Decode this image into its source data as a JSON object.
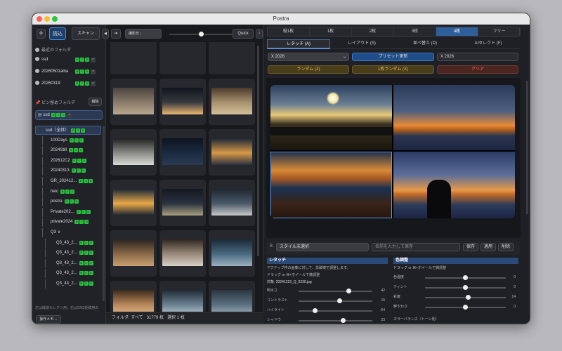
{
  "window": {
    "title": "Postra"
  },
  "left": {
    "gear": "⚙",
    "read": "読込",
    "scan": "スキャン",
    "collapse": "◀",
    "recent_header": "最近のフォルダ",
    "recent": [
      {
        "name": "ssd"
      },
      {
        "name": "20260501aiba"
      },
      {
        "name": "20260319"
      }
    ],
    "badges": [
      "B",
      "C",
      "D"
    ],
    "x": "×",
    "pin_header": "ピン留めフォルダ",
    "unpin": "解除",
    "pinned": "ssd",
    "tree": [
      {
        "name": "ssd（全体）",
        "level": 0,
        "badges": true,
        "selected": true
      },
      {
        "name": "100Days",
        "level": 1,
        "badges": true
      },
      {
        "name": "2024Still",
        "level": 1,
        "badges": true
      },
      {
        "name": "202612C2",
        "level": 1,
        "badges": true
      },
      {
        "name": "20240313",
        "level": 1,
        "badges": true
      },
      {
        "name": "GR_202412...",
        "level": 1,
        "badges": true
      },
      {
        "name": "heic",
        "level": 1,
        "badges": true
      },
      {
        "name": "postra",
        "level": 1,
        "badges": true
      },
      {
        "name": "Private202...",
        "level": 1,
        "badges": true
      },
      {
        "name": "private2024",
        "level": 1,
        "badges": true
      },
      {
        "name": "Q3",
        "level": 1,
        "badges": false,
        "toggle": "∨"
      },
      {
        "name": "Q3_43_2...",
        "level": 2,
        "badges": true
      },
      {
        "name": "Q3_43_2...",
        "level": 2,
        "badges": true
      },
      {
        "name": "Q3_43_2...",
        "level": 2,
        "badges": true
      },
      {
        "name": "Q3_43_2...",
        "level": 2,
        "badges": true
      },
      {
        "name": "Q3_43_2...",
        "level": 2,
        "badges": true
      }
    ],
    "hint": "左は爆速セレクト用。右はSNS投稿用の",
    "memo": "操作メモ ⌄"
  },
  "mid": {
    "arrow": "➔",
    "sort": "撮影日 ↓",
    "quick": "Quick",
    "info": "i",
    "status_folder": "フォルダ: すべて",
    "status_count": "31779 枚",
    "status_sel": "選択 1 枚"
  },
  "right": {
    "counts": [
      "縦1枚",
      "1枚",
      "2枚",
      "3枚",
      "4枚",
      "フリー"
    ],
    "tabs": [
      "レタッチ (A)",
      "レイアウト (S)",
      "並べ替え (D)",
      "AIセレクト (F)"
    ],
    "preset_select": "X 2026",
    "preset_update": "プリセット更新",
    "preset_name": "X 2026",
    "random": "ランダム (Z)",
    "random1": "1枚ランダム (X)",
    "clear": "クリア",
    "style_key": "S",
    "style_select": "スタイル未選択",
    "style_placeholder": "名前を入力して保存",
    "save": "保存",
    "apply": "適用",
    "delete": "削除",
    "retouch_title": "レタッチ",
    "retouch_desc1": "アクティブ枠の画像に対して、非破壊で調整します。",
    "retouch_desc2": "ドラッグ or ⌘+ホイールで微調整",
    "target": "対象: 20241223_Q_0230.jpg",
    "sliders": [
      {
        "label": "明るさ",
        "value": "42"
      },
      {
        "label": "コントラスト",
        "value": "15"
      },
      {
        "label": "ハイライト",
        "value": "-54"
      },
      {
        "label": "シャドウ",
        "value": "23"
      }
    ],
    "color_title": "色調整",
    "color_desc": "ドラッグ or ⌘+ホイールで微調整",
    "color_sliders": [
      {
        "label": "色温度",
        "value": "0"
      },
      {
        "label": "ティント",
        "value": "0"
      },
      {
        "label": "彩度",
        "value": "14"
      },
      {
        "label": "鮮やかさ",
        "value": "0"
      }
    ],
    "balance": "カラーバランス（トーン別）"
  },
  "colors": {
    "accent": "#2f6db5",
    "badge": "#2dbf3f",
    "random": "#5a4a1e",
    "clear": "#5a2a25"
  }
}
